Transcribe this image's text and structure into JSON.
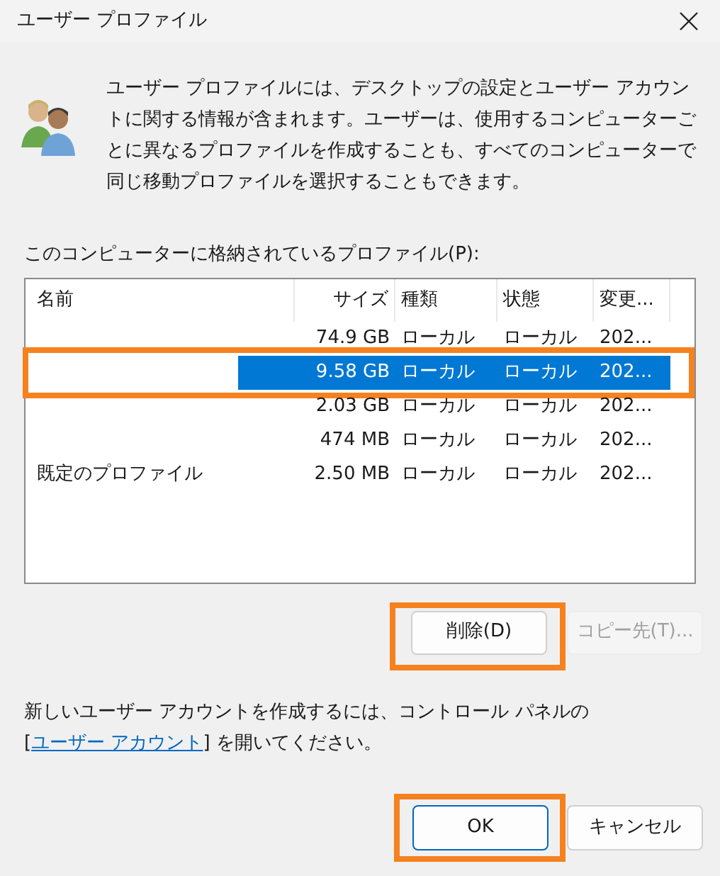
{
  "window": {
    "title": "ユーザー プロファイル"
  },
  "description": "ユーザー プロファイルには、デスクトップの設定とユーザー アカウントに関する情報が含まれます。ユーザーは、使用するコンピューターごとに異なるプロファイルを作成することも、すべてのコンピューターで同じ移動プロファイルを選択することもできます。",
  "list_label": "このコンピューターに格納されているプロファイル(P):",
  "table": {
    "columns": [
      "名前",
      "サイズ",
      "種類",
      "状態",
      "変更..."
    ],
    "rows": [
      {
        "size": "74.9 GB",
        "type": "ローカル",
        "status": "ローカル",
        "modified": "202...",
        "selected": false,
        "highlighted": false
      },
      {
        "size": "9.58 GB",
        "type": "ローカル",
        "status": "ローカル",
        "modified": "202...",
        "selected": true,
        "highlighted": true
      },
      {
        "size": "2.03 GB",
        "type": "ローカル",
        "status": "ローカル",
        "modified": "202...",
        "selected": false,
        "highlighted": false
      },
      {
        "size": "474 MB",
        "type": "ローカル",
        "status": "ローカル",
        "modified": "202...",
        "selected": false,
        "highlighted": false
      },
      {
        "name": "既定のプロファイル",
        "size": "2.50 MB",
        "type": "ローカル",
        "status": "ローカル",
        "modified": "202...",
        "selected": false,
        "highlighted": false
      }
    ]
  },
  "list_buttons": [
    {
      "label": "削除(D)",
      "disabled": false,
      "highlighted": true
    },
    {
      "label": "コピー先(T)...",
      "disabled": true,
      "highlighted": false
    }
  ],
  "footer": {
    "before": "新しいユーザー アカウントを作成するには、コントロール パネルの",
    "open": "[",
    "link": "ユーザー アカウント",
    "after": "] を開いてください。"
  },
  "dialog_buttons": [
    {
      "label": "OK",
      "default": true,
      "highlighted": true
    },
    {
      "label": "キャンセル",
      "default": false,
      "highlighted": false
    }
  ]
}
